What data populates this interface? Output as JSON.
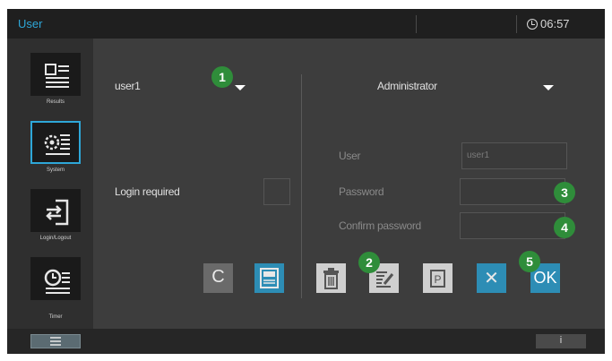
{
  "header": {
    "title": "User",
    "time": "06:57"
  },
  "sidebar": {
    "items": [
      {
        "label": "Results",
        "icon": "results-icon"
      },
      {
        "label": "System",
        "icon": "system-icon",
        "active": true
      },
      {
        "label": "Login/Logout",
        "icon": "login-logout-icon"
      },
      {
        "label": "Timer",
        "icon": "timer-icon"
      }
    ]
  },
  "left_panel": {
    "user_select": {
      "value": "user1"
    },
    "login_required_label": "Login required"
  },
  "right_panel": {
    "role_select": {
      "value": "Administrator"
    },
    "user_label": "User",
    "user_value": "user1",
    "password_label": "Password",
    "confirm_password_label": "Confirm password"
  },
  "toolbar": {
    "clear_label": "C",
    "save_icon": "save-icon",
    "delete_icon": "trash-icon",
    "edit_icon": "edit-icon",
    "rename_icon": "rename-icon",
    "cancel_label": "✕",
    "ok_label": "OK"
  },
  "callouts": [
    "1",
    "2",
    "3",
    "4",
    "5"
  ],
  "bottom": {
    "menu_icon": "hamburger-icon",
    "info_label": "i"
  },
  "colors": {
    "accent": "#2ea7d8",
    "badge": "#2f8d3a",
    "screen_bg": "#3d3d3d"
  }
}
